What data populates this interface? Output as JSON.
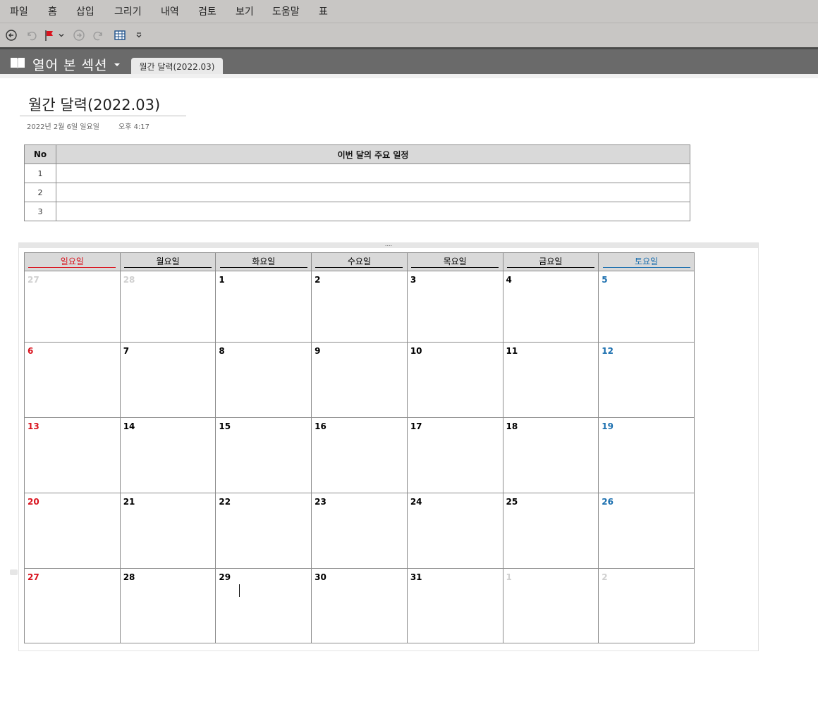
{
  "menu": [
    "파일",
    "홈",
    "삽입",
    "그리기",
    "내역",
    "검토",
    "보기",
    "도움말",
    "표"
  ],
  "qat_icons": [
    "back-icon",
    "undo-icon",
    "flag-icon",
    "forward-icon",
    "redo-icon",
    "table-icon",
    "customize-icon"
  ],
  "section": {
    "label": "열어 본 섹션",
    "tab": "월간 달력(2022.03)"
  },
  "page": {
    "title": "월간 달력(2022.03)",
    "date": "2022년 2월 6일 일요일",
    "time": "오후 4:17"
  },
  "schedule": {
    "headers": [
      "No",
      "이번 달의 주요 일정"
    ],
    "rows": [
      {
        "no": "1",
        "text": ""
      },
      {
        "no": "2",
        "text": ""
      },
      {
        "no": "3",
        "text": ""
      }
    ]
  },
  "calendar": {
    "days": [
      "일요일",
      "월요일",
      "화요일",
      "수요일",
      "목요일",
      "금요일",
      "토요일"
    ],
    "weeks": [
      [
        "27",
        "28",
        "1",
        "2",
        "3",
        "4",
        "5"
      ],
      [
        "6",
        "7",
        "8",
        "9",
        "10",
        "11",
        "12"
      ],
      [
        "13",
        "14",
        "15",
        "16",
        "17",
        "18",
        "19"
      ],
      [
        "20",
        "21",
        "22",
        "23",
        "24",
        "25",
        "26"
      ],
      [
        "27",
        "28",
        "29",
        "30",
        "31",
        "1",
        "2"
      ]
    ]
  },
  "colors": {
    "sunday": "#d9131e",
    "saturday": "#1b6faf",
    "header_bg": "#d9d9d9",
    "section_bar": "#6a6a6a"
  }
}
